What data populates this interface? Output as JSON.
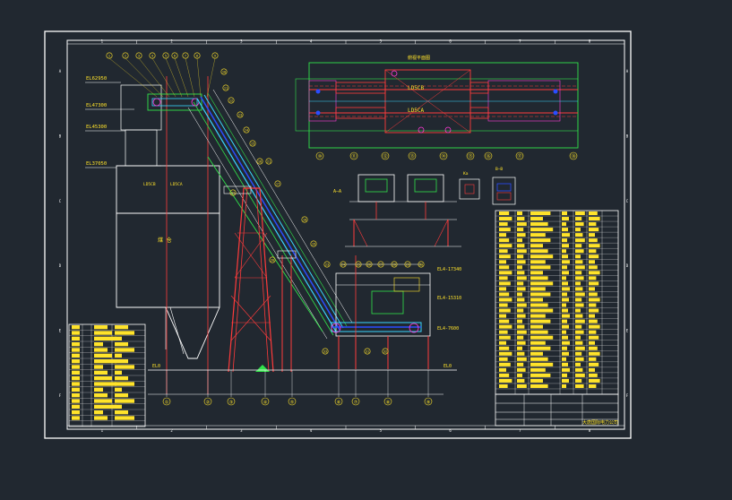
{
  "drawing": {
    "elevations": [
      "EL62950",
      "EL47300",
      "EL45300",
      "EL37050",
      "EL0",
      "EL0"
    ],
    "right_elevations": [
      "EL4-17340",
      "EL4-15310",
      "EL4-7600"
    ],
    "bunker_label": "LD5CB",
    "bunker_label_2": "LD5CA",
    "bin_text": "煤 仓",
    "plan_title": "俯视平面图",
    "plan_labels": [
      "LD5CB",
      "LD5CA"
    ],
    "section_aa": "A—A",
    "section_bb": "B—B",
    "section_ka": "Ka",
    "balloons": [
      "1",
      "2",
      "3",
      "4",
      "5",
      "6",
      "7",
      "8",
      "9",
      "10",
      "11",
      "12",
      "13",
      "14",
      "15",
      "16",
      "17",
      "18",
      "19",
      "20",
      "21",
      "22",
      "23",
      "24",
      "25",
      "26",
      "27",
      "28",
      "29",
      "30",
      "31",
      "32",
      "33"
    ],
    "grid_axes_bottom": [
      "①",
      "②",
      "③",
      "④",
      "⑤",
      "⑥",
      "⑦",
      "⑧",
      "⑨"
    ],
    "grid_axes_plan": [
      "⑩",
      "⑪",
      "⑫",
      "⑬",
      "⑭",
      "⑮",
      "⑯",
      "⑰",
      "⑱"
    ],
    "frame_top_numbers": [
      "1",
      "2",
      "3",
      "4",
      "5",
      "6",
      "7",
      "8"
    ],
    "frame_side_letters": [
      "A",
      "B",
      "C",
      "D",
      "E",
      "F"
    ],
    "title_block_text": "大唐国际电力公司"
  },
  "colors": {
    "background": "#212830",
    "frame": "#ffffff",
    "structure_red": "#ff3b3b",
    "belt_cyan": "#3ad6ff",
    "belt_blue": "#2a4dff",
    "green": "#31e24a",
    "yellow": "#ffe32a",
    "magenta": "#ff3bd8"
  }
}
